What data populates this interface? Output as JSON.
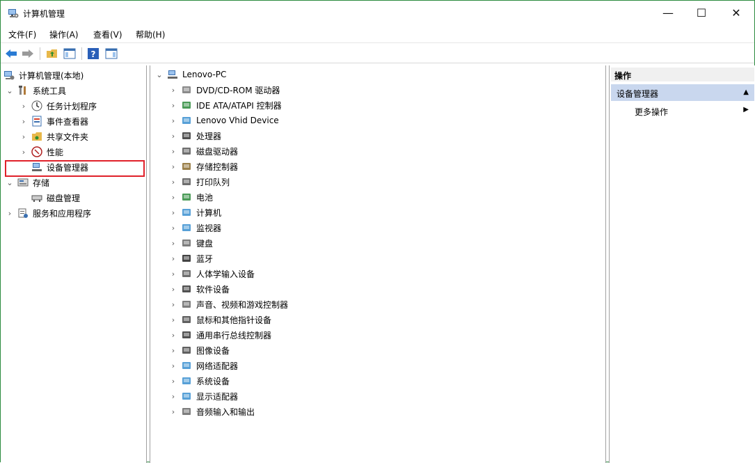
{
  "window": {
    "title": "计算机管理"
  },
  "controls": {
    "minimize": "—",
    "maximize": "☐",
    "close": "✕"
  },
  "menu": [
    "文件(F)",
    "操作(A)",
    "查看(V)",
    "帮助(H)"
  ],
  "left_tree": {
    "root": "计算机管理(本地)",
    "system_tools": "系统工具",
    "system_children": [
      "任务计划程序",
      "事件查看器",
      "共享文件夹",
      "性能",
      "设备管理器"
    ],
    "storage": "存储",
    "storage_children": [
      "磁盘管理"
    ],
    "services": "服务和应用程序"
  },
  "device_tree": {
    "root": "Lenovo-PC",
    "items": [
      "DVD/CD-ROM 驱动器",
      "IDE ATA/ATAPI 控制器",
      "Lenovo Vhid Device",
      "处理器",
      "磁盘驱动器",
      "存储控制器",
      "打印队列",
      "电池",
      "计算机",
      "监视器",
      "键盘",
      "蓝牙",
      "人体学输入设备",
      "软件设备",
      "声音、视频和游戏控制器",
      "鼠标和其他指针设备",
      "通用串行总线控制器",
      "图像设备",
      "网络适配器",
      "系统设备",
      "显示适配器",
      "音频输入和输出"
    ]
  },
  "actions": {
    "header": "操作",
    "section": "设备管理器",
    "more": "更多操作"
  }
}
